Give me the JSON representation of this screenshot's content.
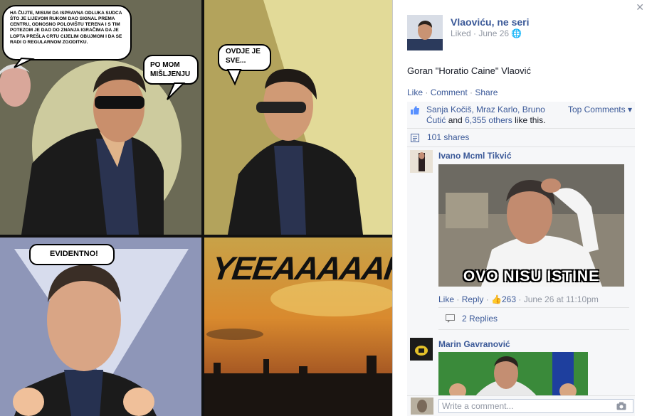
{
  "comic": {
    "bubble1": [
      "HA ČUJTE, MISUM DA ISPRAVNA ODLUKA SUDCA",
      "ŠTO JE LIJEVOM RUKOM DAO SIGNAL PREMA",
      "CENTRU, ODNOSNO POLOVIŠTU TERENA I S TIM",
      "POTEZOM JE DAO DO ZNANJA IGRAČIMA DA JE",
      "LOPTA PREŠLA CRTU CIJELIM OBUJMOM I DA SE",
      "RADI O REGULARNOM ZGODITKU."
    ],
    "bubble2": [
      "PO MOM",
      "MIŠLJENJU"
    ],
    "bubble3": [
      "OVDJE JE",
      "SVE..."
    ],
    "bubble4": "EVIDENTNO!",
    "yeah": "YEEAAAAAH!"
  },
  "post": {
    "close_icon": "close-icon",
    "page_name": "Vlaoviću, ne seri",
    "meta_liked": "Liked",
    "meta_date": "June 26",
    "caption": "Goran \"Horatio Caine\" Vlaović",
    "actions": {
      "like": "Like",
      "comment": "Comment",
      "share": "Share"
    },
    "likes": {
      "names": "Sanja Kočiš, Mraz Karlo, Bruno Ćutić",
      "and": "and",
      "others": "6,355 others",
      "suffix": "like this."
    },
    "top_comments": "Top Comments ▾",
    "shares": "101 shares"
  },
  "comments": [
    {
      "author": "Ivano Mcml Tikvić",
      "image_caption": "OVO NISU ISTINE",
      "like": "Like",
      "reply": "Reply",
      "likes_count": "263",
      "time": "June 26 at 11:10pm",
      "replies": "2 Replies"
    },
    {
      "author": "Marin Gavranović"
    }
  ],
  "write_comment": {
    "placeholder": "Write a comment..."
  },
  "colors": {
    "link": "#3b5998",
    "muted": "#9197a3",
    "panel": "#f6f7f9"
  }
}
